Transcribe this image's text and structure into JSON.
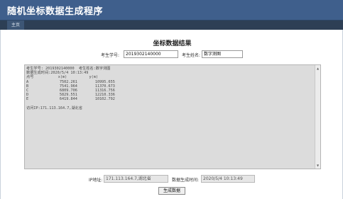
{
  "header": {
    "title": "随机坐标数据生成程序"
  },
  "nav": {
    "home": "主页"
  },
  "main": {
    "heading": "坐标数据结果",
    "student_id_label": "考生学号:",
    "student_id_value": "2019302140000",
    "student_name_label": "考生姓名:",
    "student_name_value": "数字测图",
    "result_lines": [
      "考生学号: 2019302140000  考生姓名:数字测图",
      "数据生成时间:2020/5/4 10:13:49",
      "点号           x(m)          y(m)",
      "A              7502.261        10995.655",
      "B              7541.964        11370.673",
      "C              6809.706        11316.756",
      "D              5829.551        12210.336",
      "E              6419.844        10102.792",
      "",
      "访问IP:171.113.164.7,湖北省"
    ],
    "ip_label": "IP地址:",
    "ip_value": "171.113.164.7,湖北省",
    "time_label": "数据生成时间:",
    "time_value": "2020/5/4 10:13:49",
    "generate_button": "生成数据"
  },
  "scrollbar": {
    "up_icon": "▲",
    "down_icon": "▼"
  }
}
